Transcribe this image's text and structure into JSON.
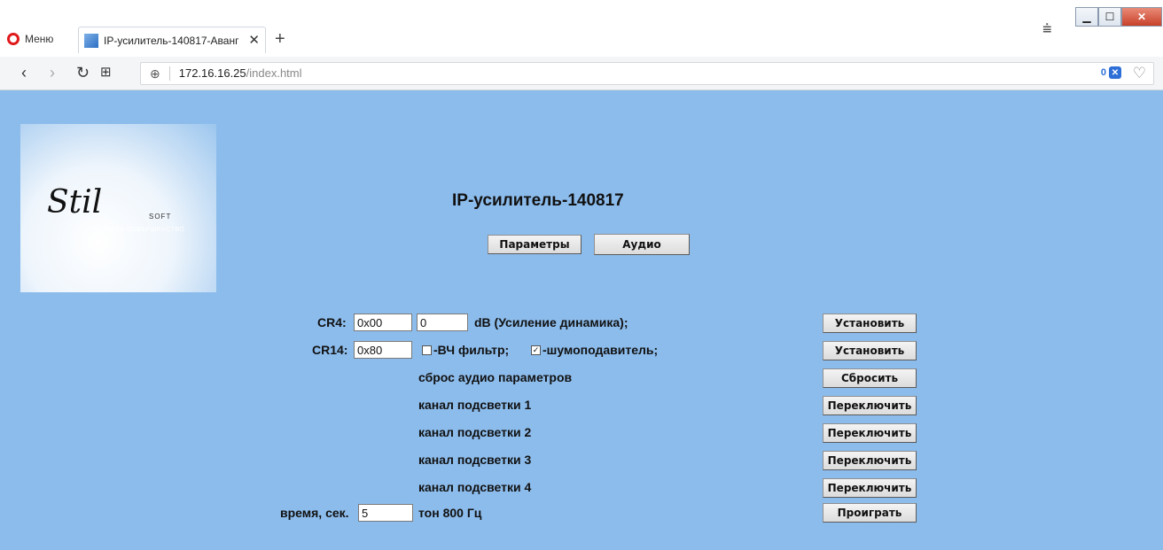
{
  "browser": {
    "menu_label": "Меню",
    "tab_title": "IP-усилитель-140817-Аванг",
    "tab_close": "✕",
    "new_tab": "+",
    "url_host": "172.16.16.25",
    "url_path": "/index.html",
    "adblock_count": "0"
  },
  "logo": {
    "word": "Stil",
    "soft": "SOFT",
    "slogan": "СОЗИДАЯ СОВЕРШЕНСТВО"
  },
  "page": {
    "title": "IP-усилитель-140817",
    "tabs": {
      "params": "Параметры",
      "audio": "Аудио"
    }
  },
  "audio": {
    "cr4": {
      "label": "CR4:",
      "hex": "0x00",
      "value": "0",
      "desc": "dB (Усиление динамика);",
      "button": "Установить"
    },
    "cr14": {
      "label": "CR14:",
      "hex": "0x80",
      "hf_filter": {
        "label": "-ВЧ фильтр;",
        "checked": false
      },
      "noise": {
        "label": "-шумоподавитель;",
        "checked": true
      },
      "button": "Установить"
    },
    "reset": {
      "label": "сброс аудио параметров",
      "button": "Сбросить"
    },
    "channels": [
      {
        "label": "канал подсветки 1",
        "button": "Переключить"
      },
      {
        "label": "канал подсветки 2",
        "button": "Переключить"
      },
      {
        "label": "канал подсветки 3",
        "button": "Переключить"
      },
      {
        "label": "канал подсветки 4",
        "button": "Переключить"
      }
    ],
    "tone": {
      "time_label": "время, сек.",
      "time_value": "5",
      "desc": "тон 800 Гц",
      "button": "Проиграть"
    }
  },
  "colors": {
    "page_bg": "#8cbcec",
    "opera_red": "#e0191b"
  }
}
